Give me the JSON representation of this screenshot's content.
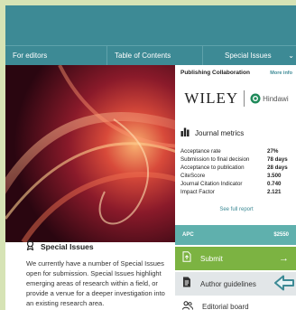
{
  "nav": {
    "items": [
      "For editors",
      "Table of Contents",
      "Special Issues"
    ]
  },
  "special_issues": {
    "title": "Special Issues",
    "description": "We currently have a number of Special Issues open for submission. Special Issues highlight emerging areas of research within a field, or provide a venue for a deeper investigation into an existing research area."
  },
  "panel": {
    "collab_label": "Publishing Collaboration",
    "more_info": "More info",
    "wiley": "WILEY",
    "hindawi": "Hindawi",
    "metrics_title": "Journal metrics",
    "metrics": [
      {
        "label": "Acceptance rate",
        "value": "27%"
      },
      {
        "label": "Submission to final decision",
        "value": "78 days"
      },
      {
        "label": "Acceptance to publication",
        "value": "28 days"
      },
      {
        "label": "CiteScore",
        "value": "3.500"
      },
      {
        "label": "Journal Citation Indicator",
        "value": "0.740"
      },
      {
        "label": "Impact Factor",
        "value": "2.121"
      }
    ],
    "full_report": "See full report",
    "apc_label": "APC",
    "apc_value": "$2550",
    "submit": "Submit",
    "author_guidelines": "Author guidelines",
    "editorial_board": "Editorial board"
  },
  "colors": {
    "teal": "#3d8a95",
    "green": "#7cb342",
    "apc_bg": "#5fb0ad",
    "background": "#d6e3b5"
  }
}
